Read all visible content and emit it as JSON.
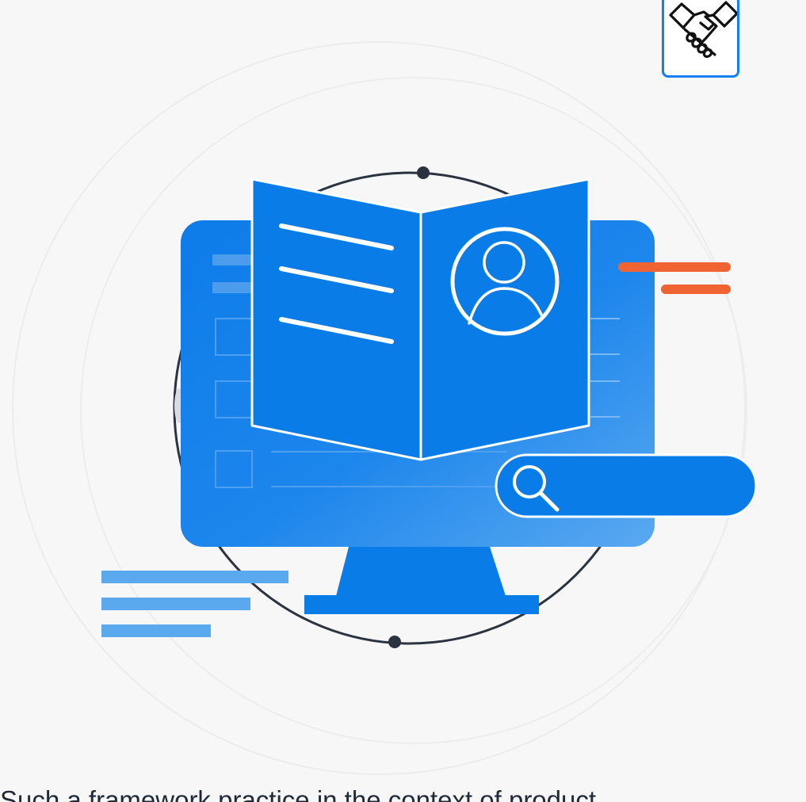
{
  "caption": {
    "text": "Such a framework practice in the context of product"
  },
  "icons": {
    "corner": "handshake-icon",
    "profile": "user-profile-icon",
    "search": "search-icon"
  },
  "colors": {
    "accent_blue": "#0a7ce8",
    "light_blue": "#5aa8ee",
    "orange": "#f06433",
    "dark_line": "#2b3340",
    "background": "#f7f7f8"
  }
}
